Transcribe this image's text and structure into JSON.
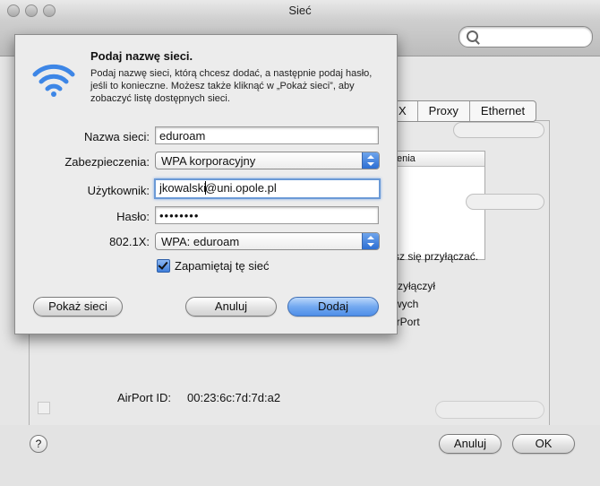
{
  "window": {
    "title": "Sieć",
    "search_placeholder": ""
  },
  "background": {
    "tabs": [
      "X",
      "Proxy",
      "Ethernet"
    ],
    "table_header": "enia",
    "texts": [
      "sz się przyłączać.",
      "rzyłączył",
      "wych",
      "irPort"
    ],
    "airport_id_label": "AirPort ID:",
    "airport_id_value": "00:23:6c:7d:7d:a2",
    "cancel_label": "Anuluj",
    "ok_label": "OK",
    "help_label": "?"
  },
  "sheet": {
    "title": "Podaj nazwę sieci.",
    "description": "Podaj nazwę sieci, którą chcesz dodać, a następnie podaj hasło, jeśli to konieczne. Możesz także kliknąć w „Pokaż sieci”, aby zobaczyć listę dostępnych sieci.",
    "fields": {
      "network_name": {
        "label": "Nazwa sieci:",
        "value": "eduroam"
      },
      "security": {
        "label": "Zabezpieczenia:",
        "value": "WPA korporacyjny"
      },
      "user": {
        "label": "Użytkownik:",
        "value_before": "jkowalski",
        "value_after": "@uni.opole.pl"
      },
      "password": {
        "label": "Hasło:",
        "value": "••••••••"
      },
      "dot1x": {
        "label": "802.1X:",
        "value": "WPA: eduroam"
      }
    },
    "remember": {
      "label": "Zapamiętaj tę sieć",
      "checked": true
    },
    "buttons": {
      "show_networks": "Pokaż sieci",
      "cancel": "Anuluj",
      "add": "Dodaj"
    }
  },
  "icons": {
    "wifi": "wifi-icon",
    "search": "search-icon",
    "popup_arrows": "updown-arrows-icon",
    "checkbox": "checkmark-icon"
  },
  "colors": {
    "accent": "#4f8ee8",
    "focus_ring": "#6b9ad6",
    "wifi_blue": "#3d86e6"
  }
}
